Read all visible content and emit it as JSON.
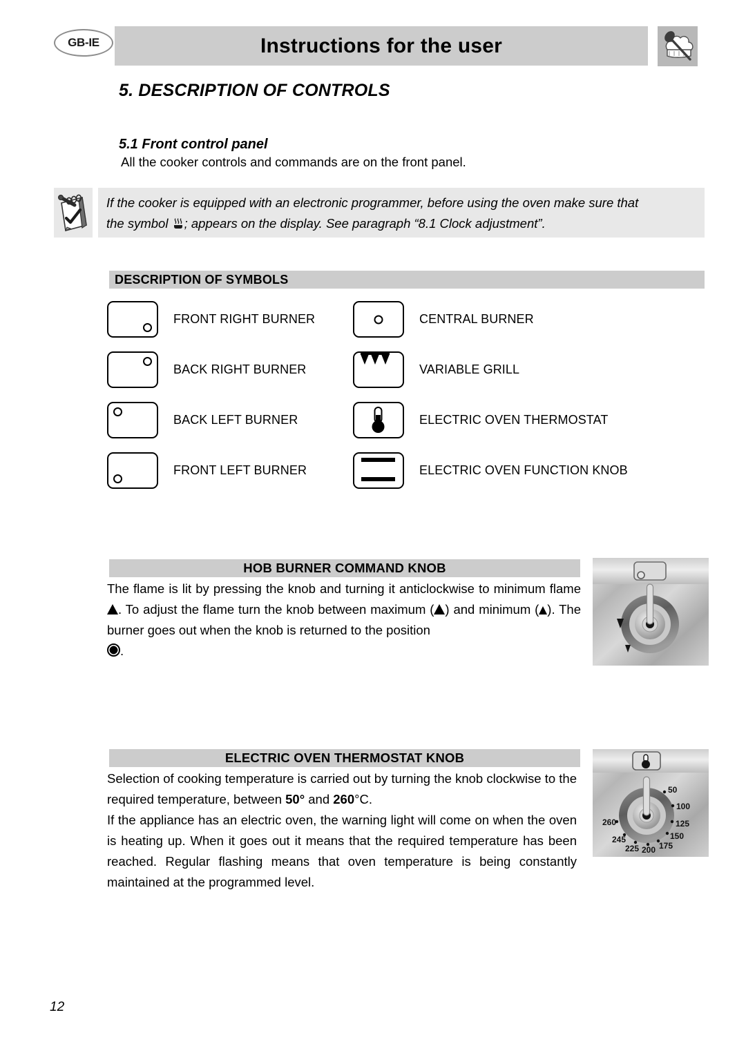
{
  "header": {
    "locale_badge": "GB-IE",
    "title": "Instructions for the user",
    "chef_icon_name": "chef-hat-spoon-icon"
  },
  "section": {
    "number_title": "5. DESCRIPTION OF CONTROLS",
    "sub_number_title": "5.1 Front control panel",
    "sub_text": "All the cooker controls and commands are on the front panel."
  },
  "note": {
    "icon_name": "notepad-check-icon",
    "line1": "If the cooker is equipped with an electronic programmer, before using the oven make sure that",
    "line2_a": "the symbol",
    "line2_symbol": "steam-dish-icon",
    "line2_b": "; appears on the display. See paragraph “8.1 Clock adjustment”."
  },
  "symbols": {
    "heading": "DESCRIPTION OF SYMBOLS",
    "rows": [
      {
        "left": {
          "label": "FRONT RIGHT BURNER",
          "icon": "burner-front-right-icon",
          "dot": "br"
        },
        "right": {
          "label": "CENTRAL BURNER",
          "icon": "burner-central-icon",
          "dot": "ctr"
        }
      },
      {
        "left": {
          "label": "BACK RIGHT BURNER",
          "icon": "burner-back-right-icon",
          "dot": "tr"
        },
        "right": {
          "label": "VARIABLE GRILL",
          "icon": "variable-grill-icon",
          "dot": "grill"
        }
      },
      {
        "left": {
          "label": "BACK LEFT BURNER",
          "icon": "burner-back-left-icon",
          "dot": "tl"
        },
        "right": {
          "label": "ELECTRIC OVEN THERMOSTAT",
          "icon": "thermometer-icon",
          "dot": "thermo"
        }
      },
      {
        "left": {
          "label": "FRONT LEFT BURNER",
          "icon": "burner-front-left-icon",
          "dot": "bl"
        },
        "right": {
          "label": "ELECTRIC OVEN FUNCTION KNOB",
          "icon": "oven-function-bars-icon",
          "dot": "bars"
        }
      }
    ]
  },
  "hob_knob": {
    "heading": "HOB BURNER COMMAND KNOB",
    "para1_a": "The flame is lit by pressing the knob and turning it anticlockwise to minimum flame",
    "para1_b": ". To adjust the flame turn the knob between maximum (",
    "para1_c": ") and minimum (",
    "para1_d": "). The burner goes out when the knob is returned to the position",
    "para1_e": ".",
    "image_name": "hob-knob-photo",
    "image_markers": [
      "maximum-flame-triangle",
      "minimum-flame-triangle"
    ]
  },
  "thermostat_knob": {
    "heading": "ELECTRIC OVEN THERMOSTAT KNOB",
    "para1_a": "Selection of cooking temperature is carried out by turning the knob clockwise to the required temperature, between ",
    "para1_min": "50°",
    "para1_mid": " and ",
    "para1_max": "260",
    "para1_unit": "°C.",
    "para2": "If the appliance has an electric oven, the warning light will come on when the oven is heating up. When it goes out it means that the required temperature has been reached. Regular flashing means that oven temperature is being constantly maintained at the programmed level.",
    "image_name": "thermostat-knob-photo",
    "dial_values": [
      "50",
      "100",
      "125",
      "150",
      "175",
      "200",
      "225",
      "245",
      "260"
    ]
  },
  "footer": {
    "page_number": "12"
  },
  "colors": {
    "bar_gray": "#cccccc",
    "note_gray": "#e8e8e8",
    "text": "#000000"
  }
}
